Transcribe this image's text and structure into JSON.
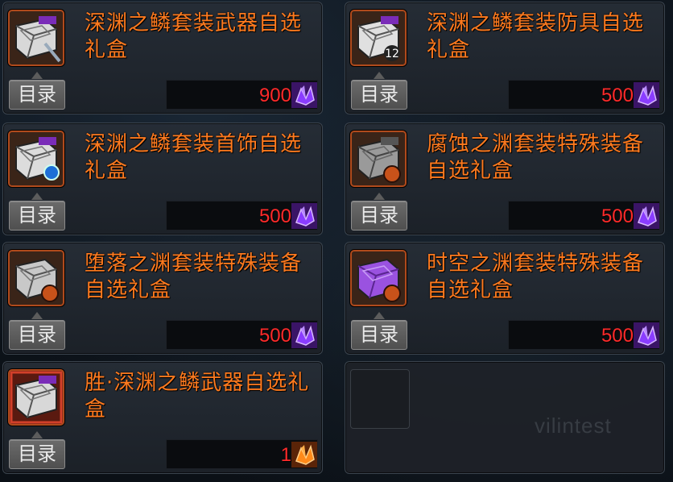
{
  "items": [
    {
      "name": "深渊之鳞套装武器自选礼盒",
      "button_label": "目录",
      "price": "900",
      "icon": "weapon-box-icon",
      "currency": "purple-crystal-icon"
    },
    {
      "name": "深渊之鳞套装防具自选礼盒",
      "button_label": "目录",
      "price": "500",
      "icon": "armor-box-icon",
      "currency": "purple-crystal-icon"
    },
    {
      "name": "深渊之鳞套装首饰自选礼盒",
      "button_label": "目录",
      "price": "500",
      "icon": "accessory-box-icon",
      "currency": "purple-crystal-icon"
    },
    {
      "name": "腐蚀之渊套装特殊装备自选礼盒",
      "button_label": "目录",
      "price": "500",
      "icon": "special-box-icon",
      "currency": "purple-crystal-icon"
    },
    {
      "name": "堕落之渊套装特殊装备自选礼盒",
      "button_label": "目录",
      "price": "500",
      "icon": "special-box-icon",
      "currency": "purple-crystal-icon"
    },
    {
      "name": "时空之渊套装特殊装备自选礼盒",
      "button_label": "目录",
      "price": "500",
      "icon": "special-box-icon",
      "currency": "purple-crystal-icon"
    },
    {
      "name": "胜·深渊之鳞武器自选礼盒",
      "button_label": "目录",
      "price": "1",
      "icon": "victory-weapon-box-icon",
      "currency": "orange-crystal-icon"
    }
  ],
  "empty_slot": {
    "watermark": "vilintest"
  },
  "colors": {
    "name": "#ff7a1e",
    "price": "#ff2a2a",
    "frame": "#b04a1c",
    "purple_currency": "#8a3cff",
    "orange_currency": "#ff8a1a"
  }
}
